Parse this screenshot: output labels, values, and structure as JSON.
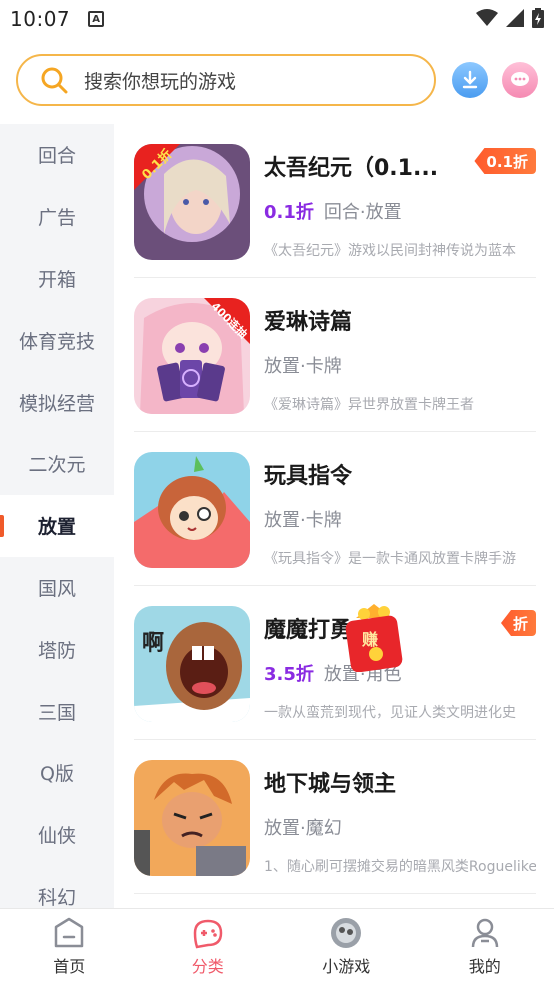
{
  "status_bar": {
    "time": "10:07"
  },
  "search": {
    "placeholder": "搜索你想玩的游戏"
  },
  "categories": [
    "回合",
    "广告",
    "开箱",
    "体育竞技",
    "模拟经营",
    "二次元",
    "放置",
    "国风",
    "塔防",
    "三国",
    "Q版",
    "仙侠",
    "科幻"
  ],
  "active_category": "放置",
  "games": [
    {
      "name": "太吾纪元（0.1...",
      "discount": "0.1折",
      "tags": "回合·放置",
      "desc": "《太吾纪元》游戏以民间封神传说为蓝本",
      "badge": "0.1折",
      "icon_text": "0.1折"
    },
    {
      "name": "爱琳诗篇",
      "discount": "",
      "tags": "放置·卡牌",
      "desc": "《爱琳诗篇》异世界放置卡牌王者",
      "badge": "",
      "icon_text": "400连抽"
    },
    {
      "name": "玩具指令",
      "discount": "",
      "tags": "放置·卡牌",
      "desc": "《玩具指令》是一款卡通风放置卡牌手游",
      "badge": "",
      "icon_text": ""
    },
    {
      "name": "魔魔打勇士",
      "discount": "3.5折",
      "tags": "放置·角色",
      "desc": "一款从蛮荒到现代，见证人类文明进化史",
      "badge": "折",
      "icon_text": ""
    },
    {
      "name": "地下城与领主",
      "discount": "",
      "tags": "放置·魔幻",
      "desc": "1、随心刷可摆摊交易的暗黑风类Roguelike",
      "badge": "",
      "icon_text": ""
    }
  ],
  "red_packet_label": "赚",
  "bottom_nav": [
    {
      "label": "首页",
      "icon": "home-icon"
    },
    {
      "label": "分类",
      "icon": "gamepad-icon",
      "active": true
    },
    {
      "label": "小游戏",
      "icon": "mini-game-icon"
    },
    {
      "label": "我的",
      "icon": "profile-icon"
    }
  ],
  "colors": {
    "accent": "#f05a2a",
    "discount": "#8a2be2",
    "search_border": "#f5b64a",
    "nav_active": "#f05a6a"
  }
}
